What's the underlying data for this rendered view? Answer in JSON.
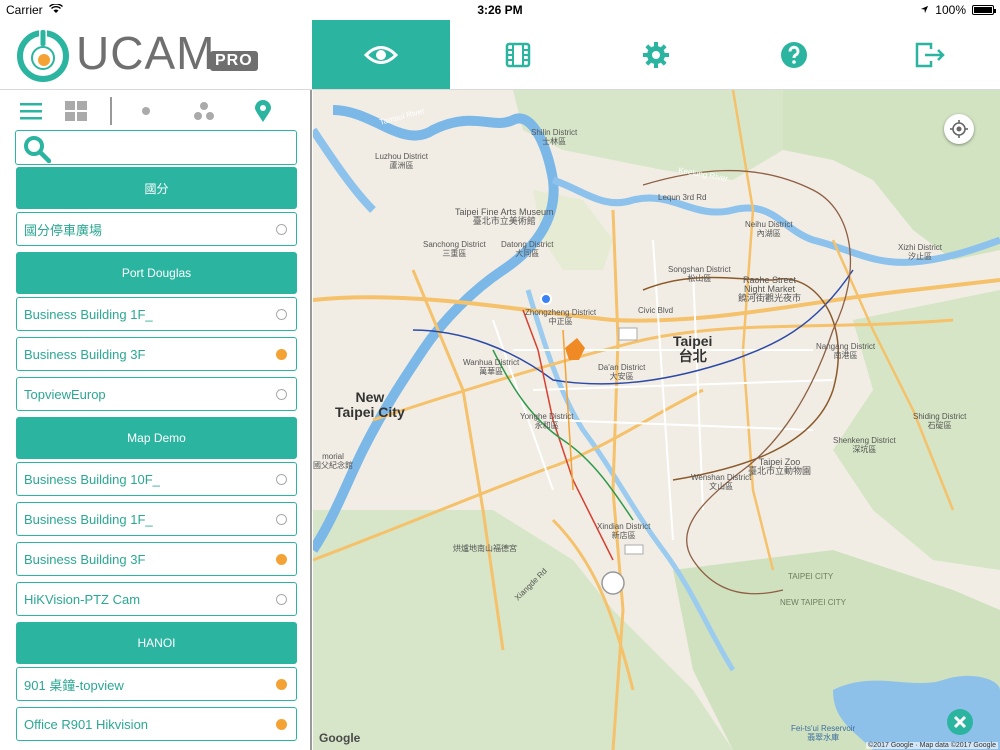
{
  "status": {
    "carrier": "Carrier",
    "time": "3:26 PM",
    "battery": "100%"
  },
  "logo": {
    "word": "UCAM",
    "badge": "PRO"
  },
  "topnav": [
    {
      "name": "live-view",
      "icon": "eye-icon",
      "active": true
    },
    {
      "name": "playback",
      "icon": "film-icon",
      "active": false
    },
    {
      "name": "settings",
      "icon": "gear-icon",
      "active": false
    },
    {
      "name": "help",
      "icon": "help-icon",
      "active": false
    },
    {
      "name": "logout",
      "icon": "logout-icon",
      "active": false
    }
  ],
  "viewbar": [
    "list-view-icon",
    "grid-view-icon",
    "single-view-icon",
    "triple-view-icon",
    "map-pin-icon"
  ],
  "search": {
    "placeholder": "",
    "value": ""
  },
  "groups": [
    {
      "title": "國分",
      "items": [
        {
          "label": "國分停車廣場",
          "active": false
        }
      ]
    },
    {
      "title": "Port Douglas",
      "items": [
        {
          "label": "Business Building 1F_",
          "active": false
        },
        {
          "label": "Business Building 3F",
          "active": true
        },
        {
          "label": "TopviewEurop",
          "active": false
        }
      ]
    },
    {
      "title": "Map Demo",
      "items": [
        {
          "label": "Business Building 10F_",
          "active": false
        },
        {
          "label": "Business Building 1F_",
          "active": false
        },
        {
          "label": "Business Building 3F",
          "active": true
        },
        {
          "label": "HiKVision-PTZ Cam",
          "active": false
        }
      ]
    },
    {
      "title": "HANOI",
      "items": [
        {
          "label": "901 桌鐘-topview",
          "active": true
        },
        {
          "label": "Office R901 Hikvision",
          "active": true
        }
      ]
    }
  ],
  "map": {
    "google": "Google",
    "attribution": "©2017 Google · Map data ©2017 Google",
    "labels": {
      "taipei_en": "Taipei",
      "taipei_zh": "台北",
      "newtaipei_en": "New",
      "newtaipei_en2": "Taipei City",
      "shilin": "Shilin District",
      "shilin_zh": "士林區",
      "luzhou": "Luzhou District",
      "luzhou_zh": "蘆洲區",
      "finearts": "Taipei Fine Arts Museum",
      "finearts_zh": "臺北市立美術館",
      "datong": "Datong District",
      "datong_zh": "大同區",
      "sanchong": "Sanchong District",
      "sanchong_zh": "三重區",
      "zhongzheng": "Zhongzheng District",
      "zhongzheng_zh": "中正區",
      "songshan": "Songshan District",
      "songshan_zh": "松山區",
      "neihu": "Neihu District",
      "neihu_zh": "內湖區",
      "raohe": "Raohe Street",
      "raohe2": "Night Market",
      "raohe_zh": "饒河街觀光夜市",
      "xizhi": "Xizhi District",
      "xizhi_zh": "汐止區",
      "wanhua": "Wanhua District",
      "wanhua_zh": "萬華區",
      "daan": "Da'an District",
      "daan_zh": "大安區",
      "nangang": "Nangang District",
      "nangang_zh": "南港區",
      "yonghe": "Yonghe District",
      "yonghe_zh": "永和區",
      "wenshan": "Wenshan District",
      "wenshan_zh": "文山區",
      "zoo": "Taipei Zoo",
      "zoo_zh": "臺北市立動物園",
      "shenkeng": "Shenkeng District",
      "shenkeng_zh": "深坑區",
      "shiding": "Shiding District",
      "shiding_zh": "石碇區",
      "xindian": "Xindian District",
      "xindian_zh": "新店區",
      "memorial": "morial",
      "memorial_zh": "國父紀念館",
      "hongwu": "烘爐地南山福德宮",
      "taipeicity": "TAIPEI CITY",
      "newtaipeicity": "NEW TAIPEI CITY",
      "feitsui": "Fei-ts'ui Reservoir",
      "feitsui_zh": "翡翠水庫",
      "tamsui": "Tamsui River",
      "keelung": "Keelung River",
      "civic": "Civic Blvd",
      "lequn": "Lequn 3rd Rd",
      "xiangde": "Xiangde Rd",
      "shenkeng_rd": "Shenkeng"
    }
  }
}
